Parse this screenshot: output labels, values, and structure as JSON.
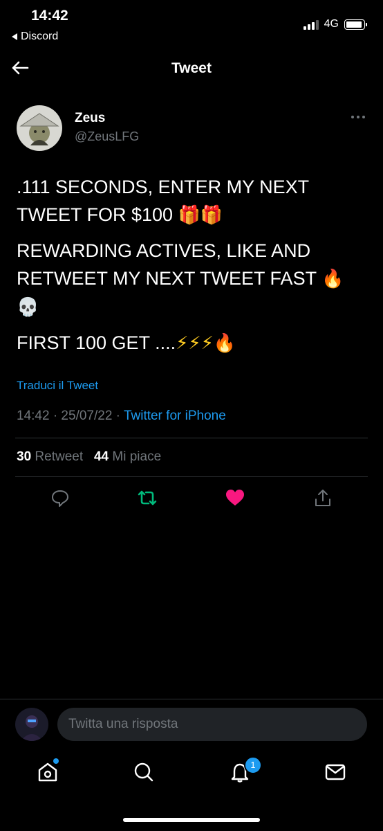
{
  "status_bar": {
    "time": "14:42",
    "back_app": "Discord",
    "network": "4G"
  },
  "header": {
    "title": "Tweet"
  },
  "tweet": {
    "author_name": "Zeus",
    "author_handle": "@ZeusLFG",
    "paragraphs": [
      {
        "text": ".111 SECONDS, ENTER MY NEXT TWEET FOR $100 ",
        "emoji": "🎁🎁"
      },
      {
        "text": "REWARDING ACTIVES, LIKE AND RETWEET MY NEXT TWEET FAST ",
        "emoji": "🔥💀"
      },
      {
        "text": "FIRST 100 GET ....",
        "emoji": "⚡⚡⚡🔥"
      }
    ],
    "translate_link": "Traduci il Tweet",
    "timestamp": "14:42 · 25/07/22 · ",
    "source": "Twitter for iPhone",
    "retweet_count": "30",
    "retweet_label": "Retweet",
    "like_count": "44",
    "like_label": "Mi piace"
  },
  "reply": {
    "placeholder": "Twitta una risposta"
  },
  "tabbar": {
    "notifications_badge": "1"
  },
  "colors": {
    "accent": "#1d9bf0",
    "retweet": "#00ba7c",
    "like": "#f91880",
    "muted": "#71767b",
    "background": "#000000"
  }
}
